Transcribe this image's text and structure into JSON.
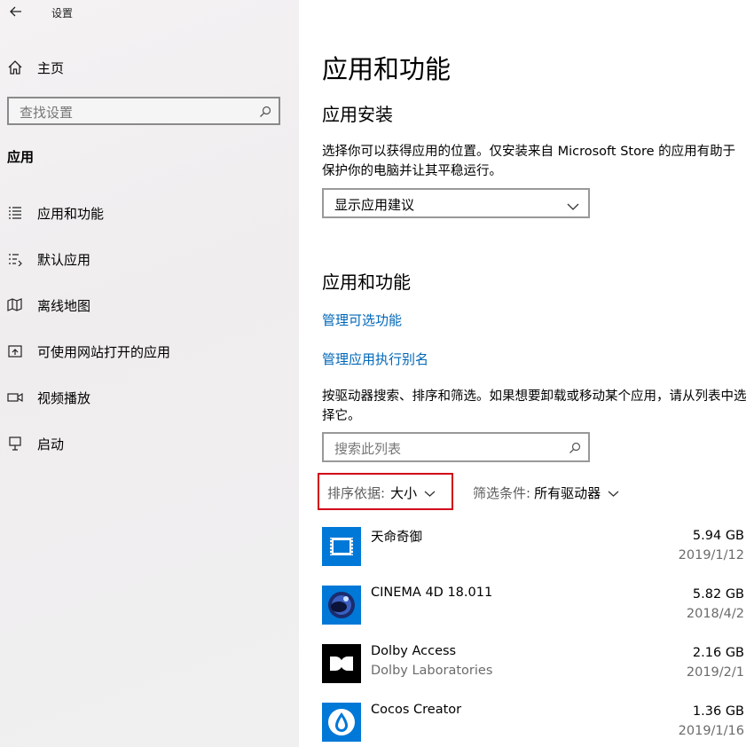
{
  "window": {
    "title": "设置"
  },
  "sidebar": {
    "home_label": "主页",
    "search_placeholder": "查找设置",
    "section_title": "应用",
    "items": [
      {
        "label": "应用和功能",
        "icon": "apps-features-icon"
      },
      {
        "label": "默认应用",
        "icon": "default-apps-icon"
      },
      {
        "label": "离线地图",
        "icon": "offline-maps-icon"
      },
      {
        "label": "可使用网站打开的应用",
        "icon": "apps-for-websites-icon"
      },
      {
        "label": "视频播放",
        "icon": "video-playback-icon"
      },
      {
        "label": "启动",
        "icon": "startup-icon"
      }
    ]
  },
  "main": {
    "page_title": "应用和功能",
    "install": {
      "heading": "应用安装",
      "description": "选择你可以获得应用的位置。仅安装来自 Microsoft Store 的应用有助于保护你的电脑并让其平稳运行。",
      "dropdown_value": "显示应用建议"
    },
    "apps": {
      "heading": "应用和功能",
      "link_optional": "管理可选功能",
      "link_alias": "管理应用执行别名",
      "description": "按驱动器搜索、排序和筛选。如果想要卸载或移动某个应用，请从列表中选择它。",
      "search_placeholder": "搜索此列表",
      "sort_label": "排序依据:",
      "sort_value": "大小",
      "filter_label": "筛选条件:",
      "filter_value": "所有驱动器"
    },
    "app_list": [
      {
        "name": "天命奇御",
        "publisher": "",
        "size": "5.94 GB",
        "date": "2019/1/12",
        "icon": "tianming-app-icon"
      },
      {
        "name": "CINEMA 4D 18.011",
        "publisher": "",
        "size": "5.82 GB",
        "date": "2018/4/2",
        "icon": "cinema4d-app-icon"
      },
      {
        "name": "Dolby Access",
        "publisher": "Dolby Laboratories",
        "size": "2.16 GB",
        "date": "2019/2/1",
        "icon": "dolby-app-icon"
      },
      {
        "name": "Cocos Creator",
        "publisher": "",
        "size": "1.36 GB",
        "date": "2019/1/16",
        "icon": "cocos-app-icon"
      }
    ]
  },
  "colors": {
    "link": "#0067b8",
    "highlight_border": "#d0021b",
    "app_tile": "#0078d7"
  }
}
